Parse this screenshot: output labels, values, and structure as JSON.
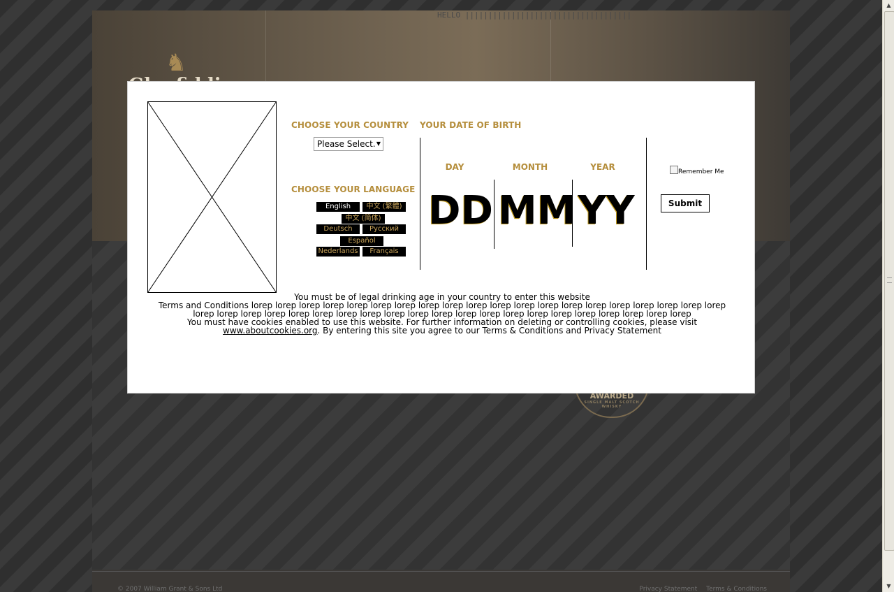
{
  "background_site": {
    "header_hint": "HELLO ||||||||||||||||||||||||||||||||||||",
    "logo_text": "Glenfiddich",
    "badge_title": "AWARDED",
    "badge_sub": "SINGLE MALT SCOTCH WHISKY",
    "footer_copyright": "© 2007 William Grant & Sons Ltd",
    "footer_links": [
      "Privacy Statement",
      "Terms & Conditions"
    ]
  },
  "modal": {
    "country": {
      "heading": "CHOOSE YOUR COUNTRY",
      "selected": "Please Select."
    },
    "language": {
      "heading": "CHOOSE YOUR LANGUAGE",
      "options": [
        "English",
        "中文 (繁體)",
        "中文 (简体)",
        "Deutsch",
        "Русский",
        "Español",
        "Nederlands",
        "Français"
      ],
      "active": "English"
    },
    "dob": {
      "heading": "YOUR DATE OF BIRTH",
      "day_label": "DAY",
      "month_label": "MONTH",
      "year_label": "YEAR",
      "day_value": "DD",
      "month_value": "MM",
      "year_value": "YY"
    },
    "remember_label": "Remember Me",
    "remember_checked": false,
    "submit_label": "Submit",
    "legal": {
      "line1": "You must be of legal drinking age in your country to enter this website",
      "line2": "Terms and Conditions lorep lorep lorep lorep lorep lorep lorep lorep lorep lorep lorep lorep lorep lorep lorep lorep lorep lorep lorep lorep lorep lorep lorep lorep lorep lorep lorep lorep lorep lorep lorep lorep lorep lorep lorep lorep lorep lorep lorep lorep lorep",
      "line3_before": "You must have cookies enabled to use this website. For further information on deleting or controlling cookies, please visit ",
      "line3_link": "www.aboutcookies.org",
      "line3_after": ". By entering this site you agree to our Terms & Conditions and Privacy Statement"
    }
  },
  "colors": {
    "heading_gold": "#b58e3c",
    "language_button_bg": "#000000",
    "modal_bg": "#ffffff"
  }
}
